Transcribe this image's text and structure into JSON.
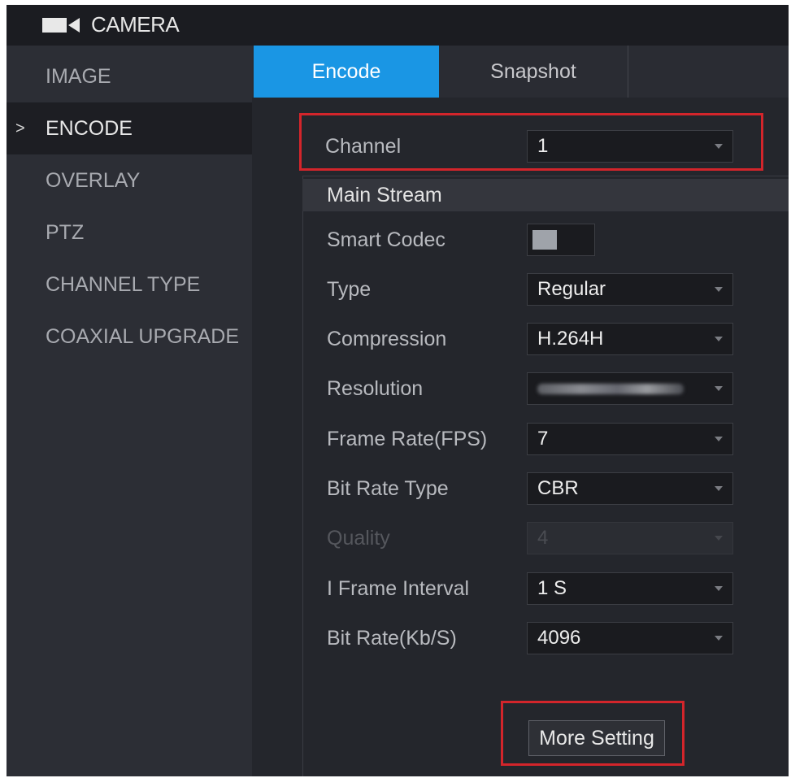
{
  "title": "CAMERA",
  "sidebar": {
    "items": [
      {
        "label": "IMAGE",
        "active": false
      },
      {
        "label": "ENCODE",
        "active": true
      },
      {
        "label": "OVERLAY",
        "active": false
      },
      {
        "label": "PTZ",
        "active": false
      },
      {
        "label": "CHANNEL TYPE",
        "active": false
      },
      {
        "label": "COAXIAL UPGRADE",
        "active": false
      }
    ]
  },
  "tabs": [
    {
      "label": "Encode",
      "active": true
    },
    {
      "label": "Snapshot",
      "active": false
    }
  ],
  "channel": {
    "label": "Channel",
    "value": "1"
  },
  "main_stream": {
    "title": "Main Stream",
    "smart_codec": {
      "label": "Smart Codec",
      "enabled": false
    },
    "type": {
      "label": "Type",
      "value": "Regular"
    },
    "compression": {
      "label": "Compression",
      "value": "H.264H"
    },
    "resolution": {
      "label": "Resolution"
    },
    "frame_rate": {
      "label": "Frame Rate(FPS)",
      "value": "7"
    },
    "bit_rate_type": {
      "label": "Bit Rate Type",
      "value": "CBR"
    },
    "quality": {
      "label": "Quality",
      "value": "4",
      "disabled": true
    },
    "i_frame_interval": {
      "label": "I Frame Interval",
      "value": "1 S"
    },
    "bit_rate": {
      "label": "Bit Rate(Kb/S)",
      "value": "4096"
    }
  },
  "more_setting_label": "More Setting",
  "colors": {
    "accent": "#1a96e4",
    "highlight_box": "#d3252b",
    "background": "#24262c"
  }
}
